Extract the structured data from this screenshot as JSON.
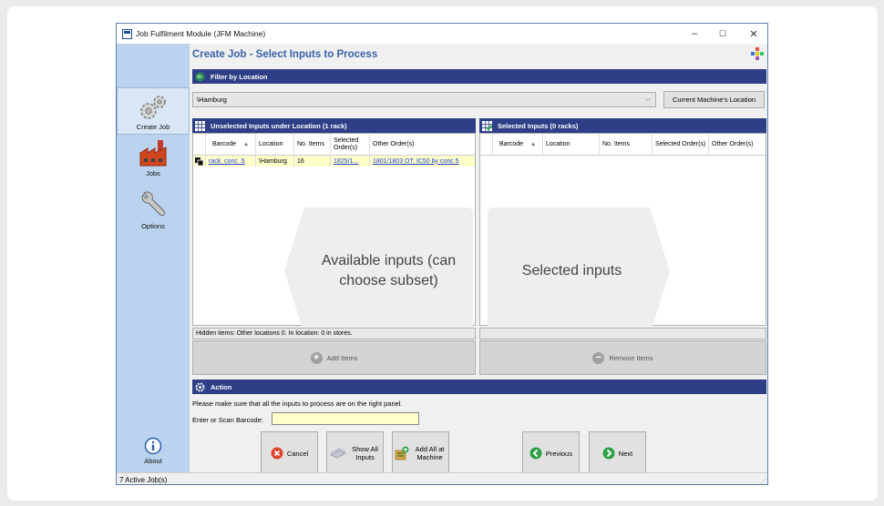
{
  "window": {
    "title": "Job Fulfilment Module (JFM Machine)",
    "minimize": "–",
    "maximize": "☐",
    "close": "✕"
  },
  "sidebar": {
    "items": [
      {
        "label": "Create Job",
        "icon": "gears-icon"
      },
      {
        "label": "Jobs",
        "icon": "factory-icon"
      },
      {
        "label": "Options",
        "icon": "wrench-icon"
      },
      {
        "label": "About",
        "icon": "info-icon"
      }
    ]
  },
  "page_title": "Create Job - Select Inputs to Process",
  "filter": {
    "header": "Filter by Location",
    "location_value": "\\Hamburg",
    "machine_location_button": "Current Machine's Location"
  },
  "unselected": {
    "header": "Unselected Inputs under Location (1 rack)",
    "columns": [
      "Barcode",
      "Location",
      "No. Items",
      "Selected Order(s)",
      "Other Order(s)"
    ],
    "rows": [
      {
        "barcode": "rack_conc_5",
        "location": "\\Hamburg",
        "items": "16",
        "selected_orders": "1825/1...",
        "other_orders": "1801/1803 OT: IC50 by conc 5"
      }
    ],
    "overlay_text": "Available inputs (can choose subset)",
    "hidden_items": "Hidden items: Other locations 0. In location: 0 in stores.",
    "add_button": "Add Items"
  },
  "selected": {
    "header": "Selected Inputs (0 racks)",
    "columns": [
      "Barcode",
      "Location",
      "No. Items",
      "Selected Order(s)",
      "Other Order(s)"
    ],
    "overlay_text": "Selected inputs",
    "remove_button": "Remove Items"
  },
  "action": {
    "header": "Action",
    "note": "Please make sure that all the inputs to process are on the right panel.",
    "scan_label": "Enter or Scan Barcode:",
    "scan_value": ""
  },
  "buttons": [
    {
      "label": "Cancel",
      "key": "F3"
    },
    {
      "label": "Show All Inputs",
      "key": "F4"
    },
    {
      "label": "Add All at Machine",
      "key": "F5"
    },
    {
      "label": "Previous",
      "key": "F7"
    },
    {
      "label": "Next",
      "key": "F8"
    }
  ],
  "status": "7 Active Job(s)"
}
